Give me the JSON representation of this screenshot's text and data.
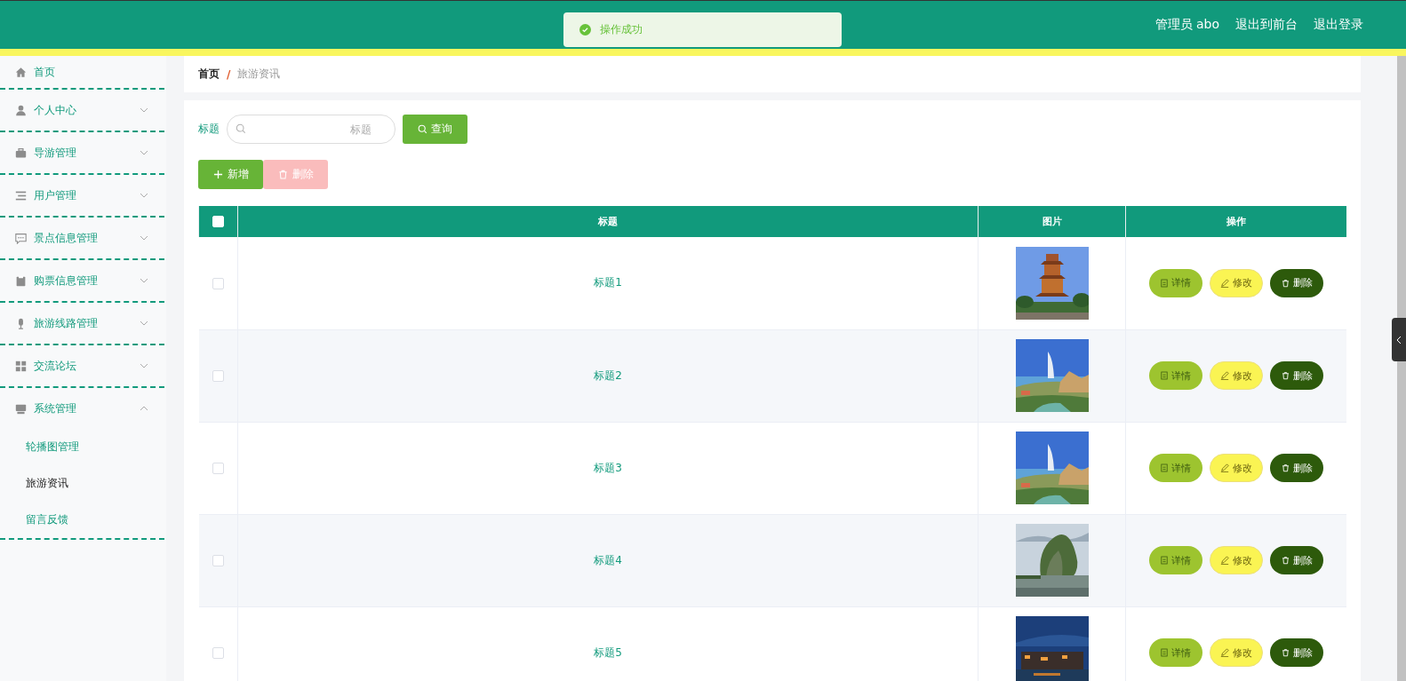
{
  "header": {
    "user": "管理员 abo",
    "links": [
      "退出到前台",
      "退出登录"
    ]
  },
  "toast": {
    "message": "操作成功"
  },
  "sidebar": {
    "items": [
      {
        "kind": "link",
        "label": "首页"
      },
      {
        "kind": "menu",
        "label": "个人中心",
        "expanded": false
      },
      {
        "kind": "menu",
        "label": "导游管理",
        "expanded": false
      },
      {
        "kind": "menu",
        "label": "用户管理",
        "expanded": false
      },
      {
        "kind": "menu",
        "label": "景点信息管理",
        "expanded": false
      },
      {
        "kind": "menu",
        "label": "购票信息管理",
        "expanded": false
      },
      {
        "kind": "menu",
        "label": "旅游线路管理",
        "expanded": false
      },
      {
        "kind": "menu",
        "label": "交流论坛",
        "expanded": false
      },
      {
        "kind": "menu",
        "label": "系统管理",
        "expanded": true,
        "children": [
          {
            "label": "轮播图管理",
            "selected": false
          },
          {
            "label": "旅游资讯",
            "selected": true
          },
          {
            "label": "留言反馈",
            "selected": false
          }
        ]
      }
    ]
  },
  "breadcrumb": {
    "items": [
      "首页",
      "旅游资讯"
    ],
    "separator": "/"
  },
  "search": {
    "label": "标题",
    "placeholder": "标题",
    "button": "查询"
  },
  "toolbar": [
    {
      "label": "新增",
      "kind": "add",
      "disabled": false
    },
    {
      "label": "删除",
      "kind": "delete",
      "disabled": true
    }
  ],
  "table": {
    "header_checked": false,
    "columns": [
      "标题",
      "图片",
      "操作"
    ],
    "rows": [
      {
        "checked": false,
        "title": "标题1",
        "actions": [
          {
            "kind": "detail",
            "label": "详情"
          },
          {
            "kind": "edit",
            "label": "修改"
          },
          {
            "kind": "delete",
            "label": "删除"
          }
        ]
      },
      {
        "checked": false,
        "title": "标题2",
        "actions": [
          {
            "kind": "detail",
            "label": "详情"
          },
          {
            "kind": "edit",
            "label": "修改"
          },
          {
            "kind": "delete",
            "label": "删除"
          }
        ]
      },
      {
        "checked": false,
        "title": "标题3",
        "actions": [
          {
            "kind": "detail",
            "label": "详情"
          },
          {
            "kind": "edit",
            "label": "修改"
          },
          {
            "kind": "delete",
            "label": "删除"
          }
        ]
      },
      {
        "checked": false,
        "title": "标题4",
        "actions": [
          {
            "kind": "detail",
            "label": "详情"
          },
          {
            "kind": "edit",
            "label": "修改"
          },
          {
            "kind": "delete",
            "label": "删除"
          }
        ]
      },
      {
        "checked": false,
        "title": "标题5",
        "actions": [
          {
            "kind": "detail",
            "label": "详情"
          },
          {
            "kind": "edit",
            "label": "修改"
          },
          {
            "kind": "delete",
            "label": "删除"
          }
        ]
      }
    ]
  }
}
